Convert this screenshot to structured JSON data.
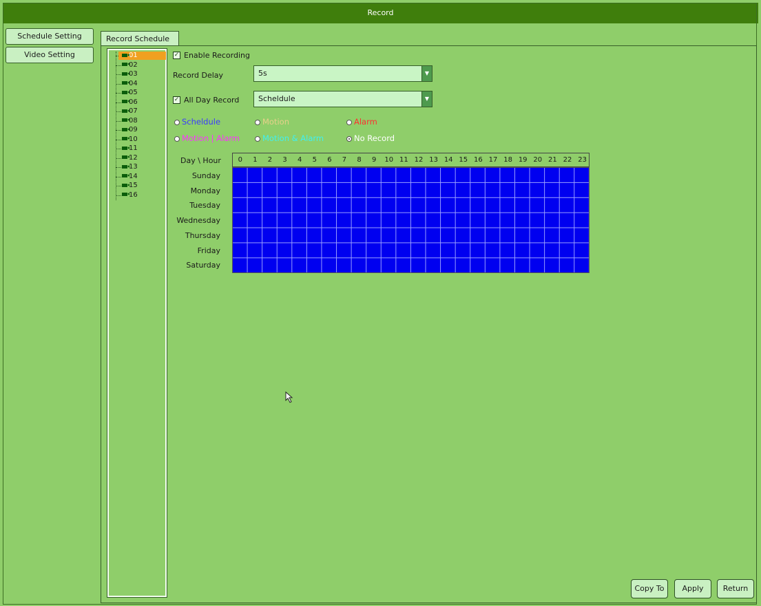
{
  "window": {
    "title": "Record"
  },
  "sidebar": {
    "items": [
      {
        "label": "Schedule Setting"
      },
      {
        "label": "Video Setting"
      }
    ]
  },
  "tabs": [
    {
      "label": "Record Schedule",
      "active": true
    }
  ],
  "channels": {
    "selected": "01",
    "items": [
      "01",
      "02",
      "03",
      "04",
      "05",
      "06",
      "07",
      "08",
      "09",
      "10",
      "11",
      "12",
      "13",
      "14",
      "15",
      "16"
    ]
  },
  "form": {
    "enable_recording": {
      "label": "Enable Recording",
      "checked": true
    },
    "record_delay": {
      "label": "Record Delay",
      "value": "5s"
    },
    "all_day_record": {
      "label": "All Day Record",
      "checked": true,
      "value": "Scheldule"
    }
  },
  "record_types": [
    {
      "label": "Scheldule",
      "color": "#3a3aff",
      "selected": false
    },
    {
      "label": "Motion",
      "color": "#e8d08a",
      "selected": false
    },
    {
      "label": "Alarm",
      "color": "#ff3030",
      "selected": false
    },
    {
      "label": "Motion | Alarm",
      "color": "#ff30ff",
      "selected": false
    },
    {
      "label": "Motion & Alarm",
      "color": "#40f0f0",
      "selected": false
    },
    {
      "label": "No Record",
      "color": "#ffffff",
      "selected": true
    }
  ],
  "schedule": {
    "corner_label": "Day \\ Hour",
    "hours": [
      "0",
      "1",
      "2",
      "3",
      "4",
      "5",
      "6",
      "7",
      "8",
      "9",
      "10",
      "11",
      "12",
      "13",
      "14",
      "15",
      "16",
      "17",
      "18",
      "19",
      "20",
      "21",
      "22",
      "23"
    ],
    "days": [
      "Sunday",
      "Monday",
      "Tuesday",
      "Wednesday",
      "Thursday",
      "Friday",
      "Saturday"
    ],
    "fill_color": "#0000f0",
    "fill_mode": "Scheldule"
  },
  "buttons": {
    "copy_to": "Copy To",
    "apply": "Apply",
    "return": "Return"
  },
  "colors": {
    "titlebar": "#3f7e0c",
    "background": "#8fce6a",
    "selected_channel": "#f0a020"
  }
}
